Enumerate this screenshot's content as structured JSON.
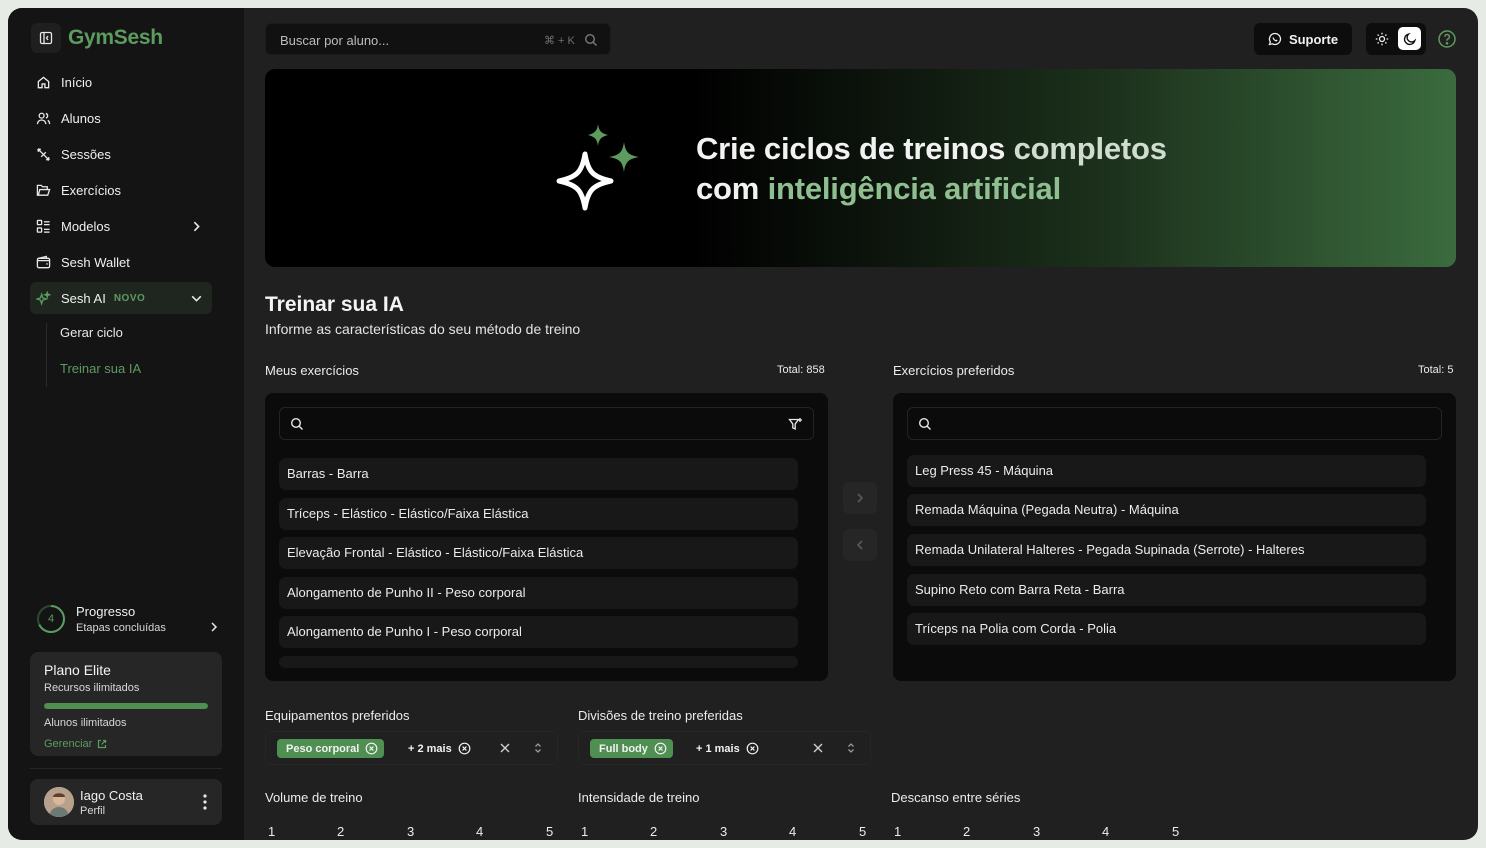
{
  "app": {
    "name": "GymSesh"
  },
  "nav": {
    "inicio": "Início",
    "alunos": "Alunos",
    "sessoes": "Sessões",
    "exercicios": "Exercícios",
    "modelos": "Modelos",
    "wallet": "Sesh Wallet",
    "ai": "Sesh AI",
    "ai_badge": "NOVO",
    "sub_gerar": "Gerar ciclo",
    "sub_treinar": "Treinar sua IA"
  },
  "progress": {
    "count": "4",
    "title": "Progresso",
    "subtitle": "Etapas concluídas"
  },
  "plan": {
    "title": "Plano Elite",
    "resources": "Recursos ilimitados",
    "usage_fraction": 1.0,
    "students": "Alunos ilimitados",
    "manage": "Gerenciar"
  },
  "user": {
    "name": "Iago Costa",
    "role": "Perfil"
  },
  "topbar": {
    "search_placeholder": "Buscar por aluno...",
    "search_shortcut": "⌘ + K",
    "support": "Suporte"
  },
  "banner": {
    "line1_a": "Crie ciclos de treinos ",
    "line1_b": "completos",
    "line2_a": "com ",
    "line2_b": "inteligência artificial"
  },
  "section": {
    "title": "Treinar sua IA",
    "subtitle": "Informe as características do seu método de treino"
  },
  "my_exercises": {
    "label": "Meus exercícios",
    "total": "Total: 858",
    "items": [
      "Barras - Barra",
      "Tríceps - Elástico - Elástico/Faixa Elástica",
      "Elevação Frontal - Elástico - Elástico/Faixa Elástica",
      "Alongamento de Punho II - Peso corporal",
      "Alongamento de Punho I - Peso corporal"
    ]
  },
  "preferred_exercises": {
    "label": "Exercícios preferidos",
    "total": "Total: 5",
    "items": [
      "Leg Press 45 - Máquina",
      "Remada Máquina (Pegada Neutra) - Máquina",
      "Remada Unilateral Halteres - Pegada Supinada (Serrote) - Halteres",
      "Supino Reto com Barra Reta - Barra",
      "Tríceps na Polia com Corda - Polia"
    ]
  },
  "equipment": {
    "label": "Equipamentos preferidos",
    "chip": "Peso corporal",
    "more": "+ 2 mais"
  },
  "divisions": {
    "label": "Divisões de treino preferidas",
    "chip": "Full body",
    "more": "+ 1 mais"
  },
  "scales": {
    "volume": {
      "label": "Volume de treino",
      "ticks": [
        "1",
        "2",
        "3",
        "4",
        "5"
      ]
    },
    "intensidade": {
      "label": "Intensidade de treino",
      "ticks": [
        "1",
        "2",
        "3",
        "4",
        "5"
      ]
    },
    "descanso": {
      "label": "Descanso entre séries",
      "ticks": [
        "1",
        "2",
        "3",
        "4",
        "5"
      ]
    }
  },
  "colors": {
    "accent": "#5d9b5f",
    "sidebar_bg": "#141414",
    "main_bg": "#202020",
    "panel_bg": "#0b0b0b"
  }
}
